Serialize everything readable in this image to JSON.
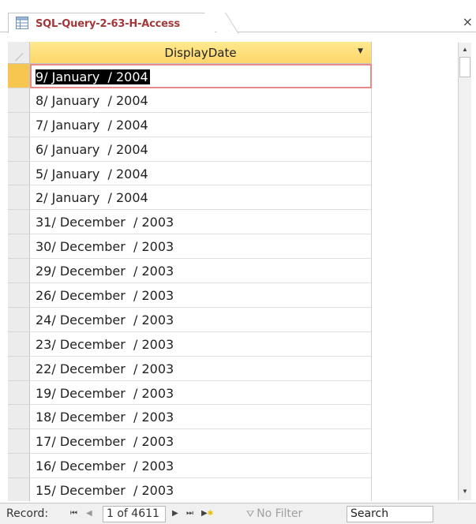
{
  "tab": {
    "title": "SQL-Query-2-63-H-Access",
    "icon": "datasheet-icon",
    "close_glyph": "×"
  },
  "grid": {
    "column_header": "DisplayDate",
    "rows": [
      "9/ January  / 2004",
      "8/ January  / 2004",
      "7/ January  / 2004",
      "6/ January  / 2004",
      "5/ January  / 2004",
      "2/ January  / 2004",
      "31/ December  / 2003",
      "30/ December  / 2003",
      "29/ December  / 2003",
      "26/ December  / 2003",
      "24/ December  / 2003",
      "23/ December  / 2003",
      "22/ December  / 2003",
      "19/ December  / 2003",
      "18/ December  / 2003",
      "17/ December  / 2003",
      "16/ December  / 2003",
      "15/ December  / 2003"
    ]
  },
  "navbar": {
    "record_label": "Record:",
    "position": "1 of 4611",
    "filter_label": "No Filter",
    "search_placeholder": "Search"
  },
  "colors": {
    "header": "#fcd66a",
    "current_selector": "#f6c651",
    "tab_title": "#a4373a",
    "current_cell_border": "#e88a8a"
  }
}
